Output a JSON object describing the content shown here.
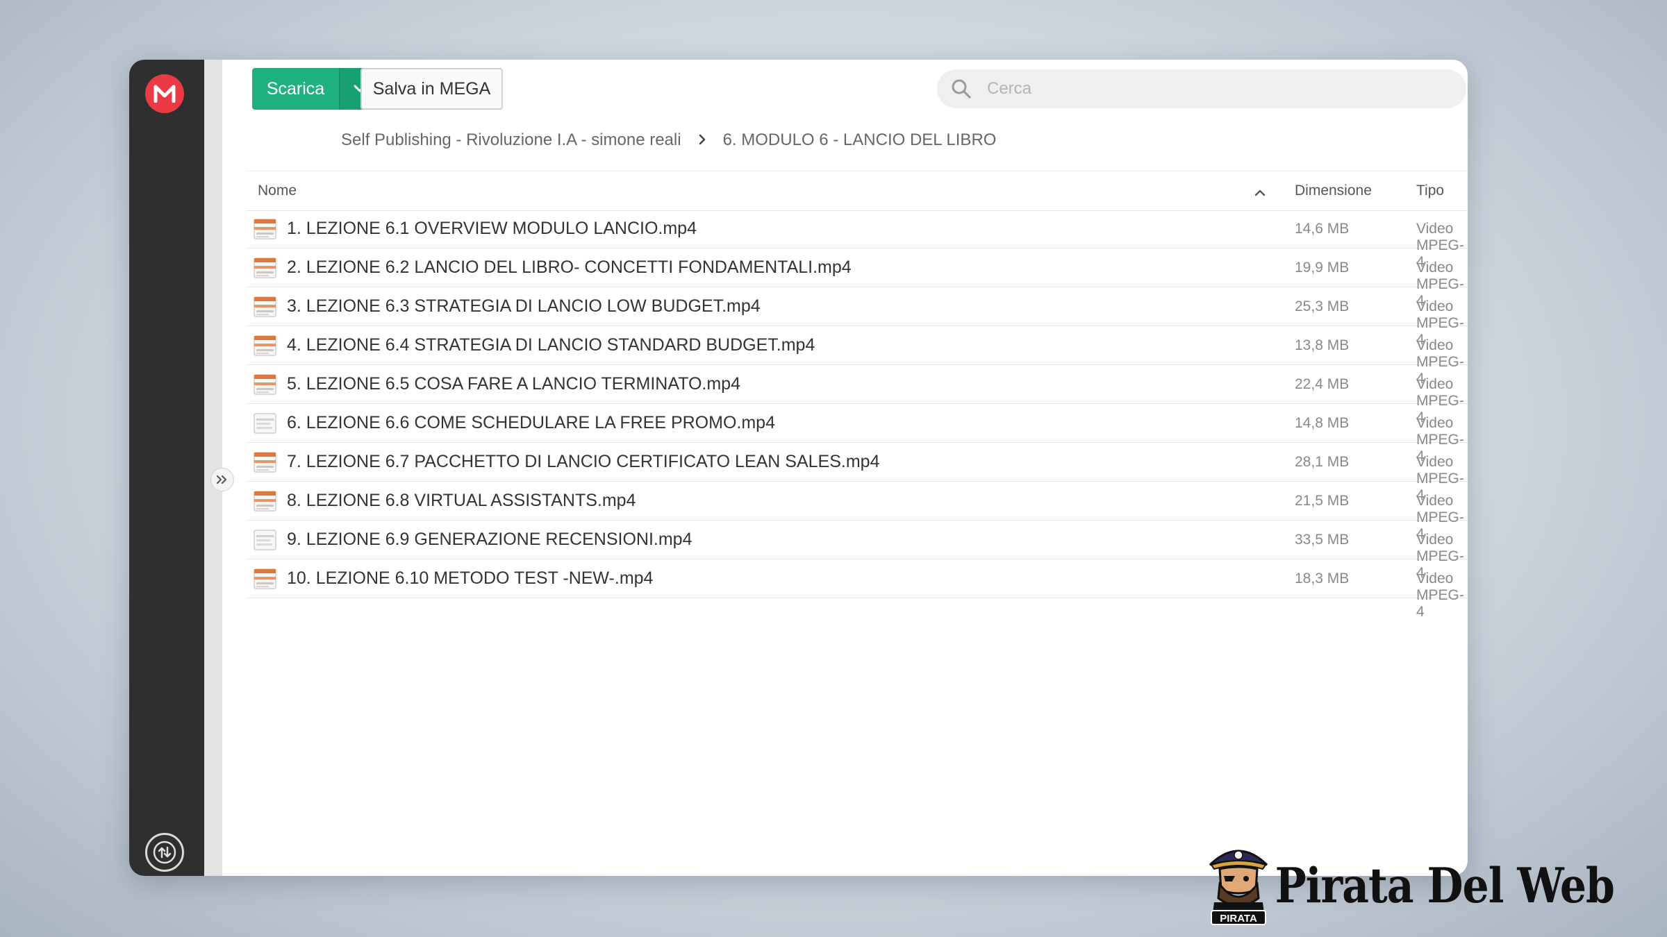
{
  "toolbar": {
    "download_label": "Scarica",
    "save_label": "Salva in MEGA",
    "search_placeholder": "Cerca"
  },
  "breadcrumb": {
    "parent": "Self Publishing - Rivoluzione I.A - simone reali",
    "current": "6. MODULO 6 - LANCIO DEL LIBRO"
  },
  "table": {
    "headers": {
      "name": "Nome",
      "size": "Dimensione",
      "type": "Tipo"
    },
    "rows": [
      {
        "name": "1. LEZIONE 6.1 OVERVIEW MODULO LANCIO.mp4",
        "size": "14,6 MB",
        "type": "Video MPEG-4",
        "thumb": "orange"
      },
      {
        "name": "2. LEZIONE 6.2 LANCIO DEL LIBRO- CONCETTI FONDAMENTALI.mp4",
        "size": "19,9 MB",
        "type": "Video MPEG-4",
        "thumb": "orange"
      },
      {
        "name": "3. LEZIONE 6.3 STRATEGIA DI LANCIO LOW BUDGET.mp4",
        "size": "25,3 MB",
        "type": "Video MPEG-4",
        "thumb": "orange"
      },
      {
        "name": "4. LEZIONE 6.4 STRATEGIA DI LANCIO STANDARD BUDGET.mp4",
        "size": "13,8 MB",
        "type": "Video MPEG-4",
        "thumb": "orange"
      },
      {
        "name": "5. LEZIONE 6.5 COSA FARE A LANCIO TERMINATO.mp4",
        "size": "22,4 MB",
        "type": "Video MPEG-4",
        "thumb": "orange"
      },
      {
        "name": "6. LEZIONE 6.6 COME SCHEDULARE LA FREE PROMO.mp4",
        "size": "14,8 MB",
        "type": "Video MPEG-4",
        "thumb": "gray"
      },
      {
        "name": "7. LEZIONE 6.7 PACCHETTO DI LANCIO CERTIFICATO LEAN SALES.mp4",
        "size": "28,1 MB",
        "type": "Video MPEG-4",
        "thumb": "orange"
      },
      {
        "name": "8. LEZIONE 6.8 VIRTUAL ASSISTANTS.mp4",
        "size": "21,5 MB",
        "type": "Video MPEG-4",
        "thumb": "orange"
      },
      {
        "name": "9. LEZIONE 6.9 GENERAZIONE RECENSIONI.mp4",
        "size": "33,5 MB",
        "type": "Video MPEG-4",
        "thumb": "gray"
      },
      {
        "name": "10. LEZIONE 6.10 METODO TEST -NEW-.mp4",
        "size": "18,3 MB",
        "type": "Video MPEG-4",
        "thumb": "orange"
      }
    ]
  },
  "watermark": {
    "brand": "Pirata Del Web",
    "badge": "PIRATA"
  },
  "icons": {
    "logo": "mega-logo-icon",
    "transfer": "transfer-manager-icon",
    "expand": "double-chevron-right-icon",
    "search": "search-icon",
    "dropdown": "chevron-down-icon",
    "sort": "sort-ascending-icon"
  },
  "colors": {
    "brand_red": "#eb3a45",
    "download_green": "#1fb27f",
    "sidebar": "#2f2f2f"
  }
}
